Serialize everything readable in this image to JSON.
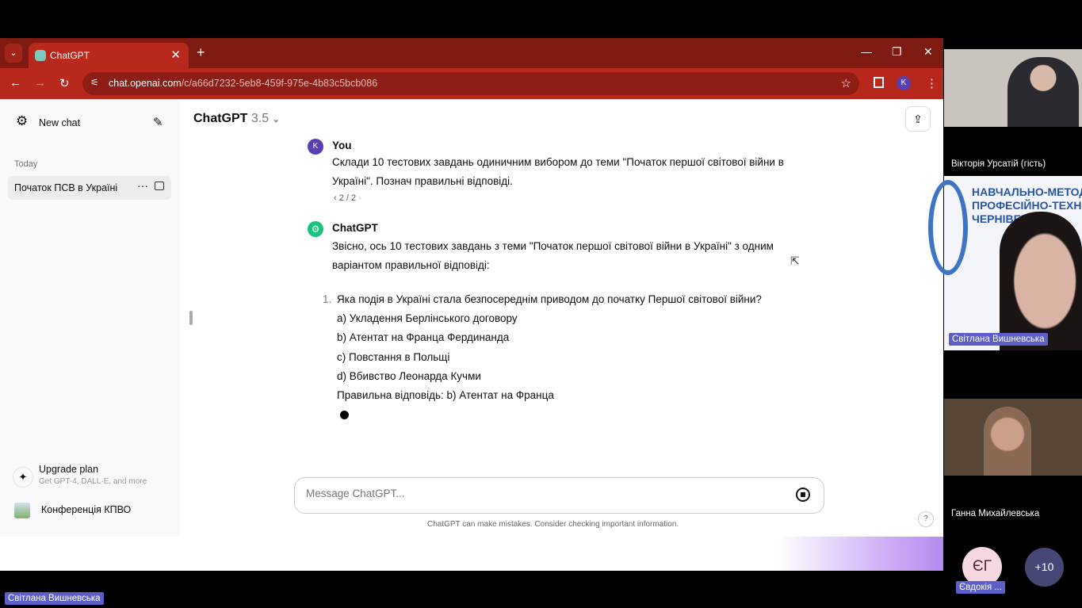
{
  "browser": {
    "tab_title": "ChatGPT",
    "url_host": "chat.openai.com",
    "url_path": "/c/a66d7232-5eb8-459f-975e-4b83c5bcb086",
    "profile": "K"
  },
  "sidebar": {
    "new_chat": "New chat",
    "section": "Today",
    "history": [
      {
        "label": "Початок ПСВ в Україні"
      }
    ],
    "upgrade_title": "Upgrade plan",
    "upgrade_sub": "Get GPT-4, DALL·E, and more",
    "user": "Конференція КПВО"
  },
  "header": {
    "model": "ChatGPT",
    "version": "3.5"
  },
  "messages": {
    "user_name": "You",
    "user_avatar": "K",
    "user_text": "Склади 10 тестових завдань одиничним вибором до теми \"Початок першої світової війни в Україні\". Познач правильні відповіді.",
    "pager": "2 / 2",
    "bot_name": "ChatGPT",
    "bot_intro": "Звісно, ось 10 тестових завдань з теми \"Початок першої світової війни в Україні\" з одним варіантом правильної відповіді:",
    "question_num": "1.",
    "question": "Яка подія в Україні стала безпосереднім приводом до початку Першої світової війни?",
    "options": [
      "a) Укладення Берлінського договору",
      "b) Атентат на Франца Фердинанда",
      "c) Повстання в Польщі",
      "d) Вбивство Леонарда Кучми"
    ],
    "answer": "Правильна відповідь: b) Атентат на Франца"
  },
  "composer": {
    "placeholder": "Message ChatGPT...",
    "disclaimer": "ChatGPT can make mistakes. Consider checking important information.",
    "help": "?"
  },
  "meeting": {
    "participants": [
      "Вікторія Урсатій (гість)",
      "Світлана Вишневська",
      "Ганна Михайлевська"
    ],
    "banner": [
      "НАВЧАЛЬНО-МЕТОД",
      "ПРОФЕСІЙНО-ТЕХНІЧ",
      "ЧЕРНІВЕЦ"
    ],
    "avatar_initials": "ЄГ",
    "avatar_name": "Євдокія ...",
    "more": "+10",
    "presenter": "Світлана Вишневська"
  }
}
